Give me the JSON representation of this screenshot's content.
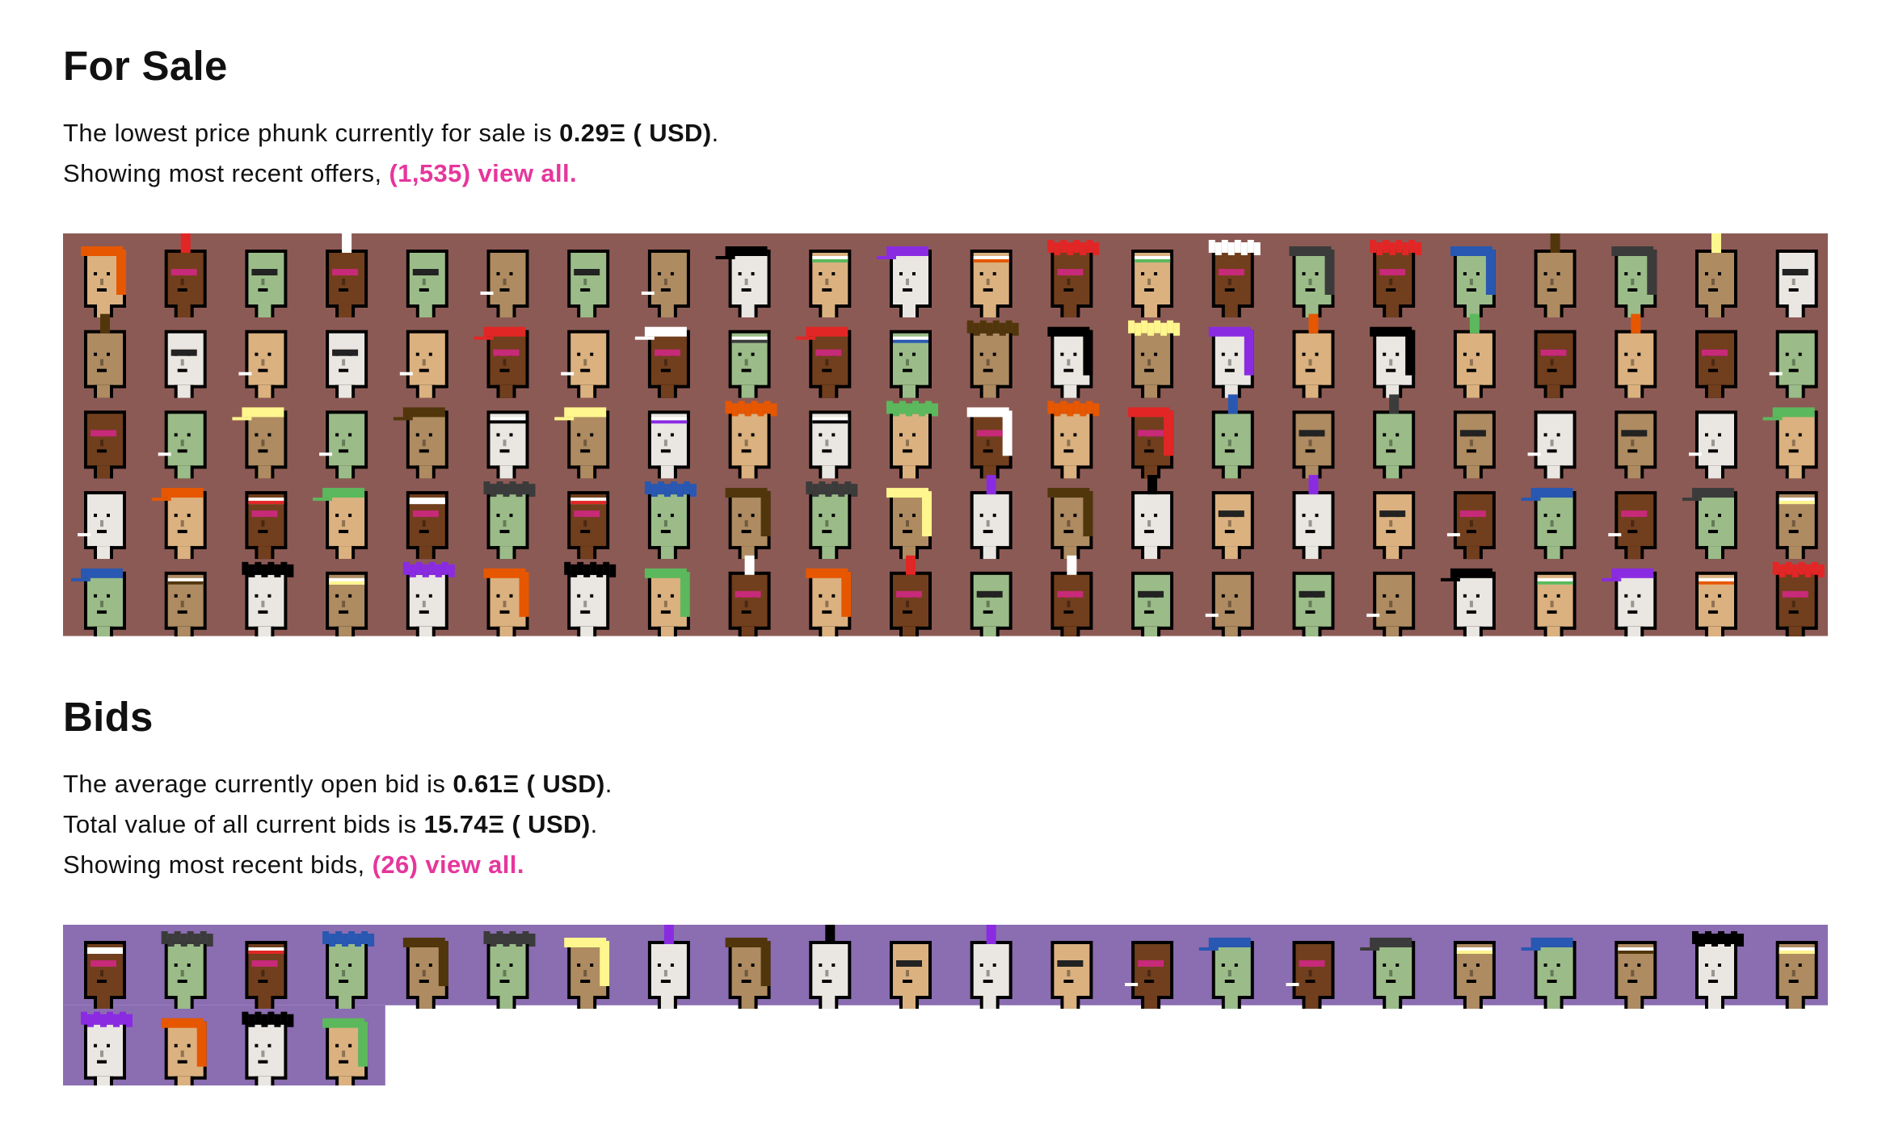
{
  "for_sale": {
    "heading": "For Sale",
    "lowest_prefix": "The lowest price phunk currently for sale is ",
    "lowest_value": "0.29Ξ ( USD)",
    "lowest_suffix": ".",
    "showing_prefix": "Showing most recent offers, ",
    "view_all_link": "(1,535) view all.",
    "background_color": "#8c5a55",
    "rows": 5,
    "cols": 22
  },
  "bids": {
    "heading": "Bids",
    "average_prefix": "The average currently open bid is ",
    "average_value": "0.61Ξ ( USD)",
    "average_suffix": ".",
    "total_prefix": "Total value of all current bids is ",
    "total_value": "15.74Ξ ( USD)",
    "total_suffix": ".",
    "showing_prefix": "Showing most recent bids, ",
    "view_all_link": "(26) view all.",
    "background_color": "#8b6db1",
    "count": 26,
    "cols": 22
  },
  "colors": {
    "link": "#e6369c",
    "skin_tones": [
      "#dbb180",
      "#ae8b61",
      "#713f1d",
      "#eae6e1",
      "#9bbc88"
    ],
    "hair_tones": [
      "#000000",
      "#e22626",
      "#fff68e",
      "#5cb85c",
      "#2858b1",
      "#8a2be2",
      "#ffffff",
      "#51360c",
      "#e65700",
      "#3b3b3b"
    ]
  }
}
